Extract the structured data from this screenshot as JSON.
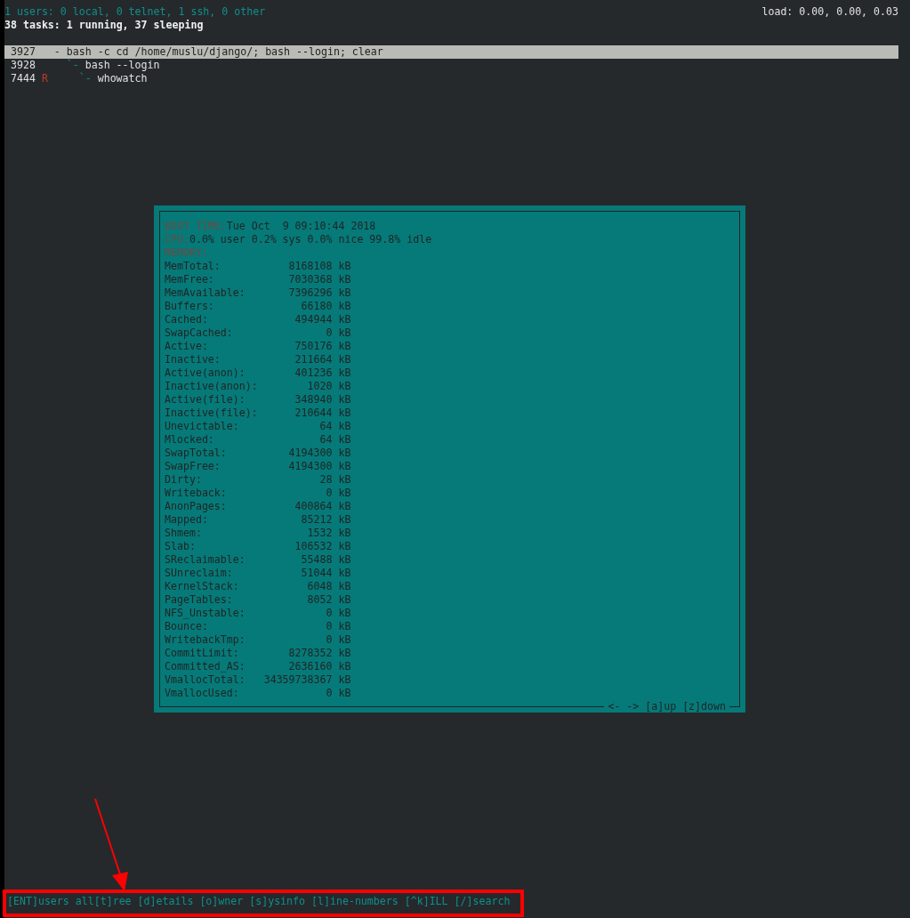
{
  "header": {
    "users_line": "1 users: 0 local, 0 telnet, 1 ssh, 0 other",
    "load": "load: 0.00, 0.00, 0.03",
    "tasks_line": "38 tasks: 1 running, 37 sleeping"
  },
  "processes": [
    {
      "pid": "3927",
      "prefix": "-",
      "command": "bash -c cd /home/muslu/django/; bash --login; clear",
      "selected": true,
      "children": [
        {
          "pid": "3928",
          "prefix": "`-",
          "command": "bash --login",
          "selected": false,
          "children": [
            {
              "pid": "7444",
              "state": "R",
              "prefix": "`-",
              "command": "whowatch",
              "selected": false
            }
          ]
        }
      ]
    }
  ],
  "sysinfo": {
    "boot_label": "BOOT TIME:",
    "boot_value": "Tue Oct  9 09:10:44 2018",
    "cpu_label": "CPU:",
    "cpu_value": "0.0% user 0.2% sys 0.0% nice 99.8% idle",
    "memory_label": "MEMORY:",
    "memory": [
      {
        "name": "MemTotal:",
        "value": "8168108",
        "unit": "kB"
      },
      {
        "name": "MemFree:",
        "value": "7030368",
        "unit": "kB"
      },
      {
        "name": "MemAvailable:",
        "value": "7396296",
        "unit": "kB"
      },
      {
        "name": "Buffers:",
        "value": "66180",
        "unit": "kB"
      },
      {
        "name": "Cached:",
        "value": "494944",
        "unit": "kB"
      },
      {
        "name": "SwapCached:",
        "value": "0",
        "unit": "kB"
      },
      {
        "name": "Active:",
        "value": "750176",
        "unit": "kB"
      },
      {
        "name": "Inactive:",
        "value": "211664",
        "unit": "kB"
      },
      {
        "name": "Active(anon):",
        "value": "401236",
        "unit": "kB"
      },
      {
        "name": "Inactive(anon):",
        "value": "1020",
        "unit": "kB"
      },
      {
        "name": "Active(file):",
        "value": "348940",
        "unit": "kB"
      },
      {
        "name": "Inactive(file):",
        "value": "210644",
        "unit": "kB"
      },
      {
        "name": "Unevictable:",
        "value": "64",
        "unit": "kB"
      },
      {
        "name": "Mlocked:",
        "value": "64",
        "unit": "kB"
      },
      {
        "name": "SwapTotal:",
        "value": "4194300",
        "unit": "kB"
      },
      {
        "name": "SwapFree:",
        "value": "4194300",
        "unit": "kB"
      },
      {
        "name": "Dirty:",
        "value": "28",
        "unit": "kB"
      },
      {
        "name": "Writeback:",
        "value": "0",
        "unit": "kB"
      },
      {
        "name": "AnonPages:",
        "value": "400864",
        "unit": "kB"
      },
      {
        "name": "Mapped:",
        "value": "85212",
        "unit": "kB"
      },
      {
        "name": "Shmem:",
        "value": "1532",
        "unit": "kB"
      },
      {
        "name": "Slab:",
        "value": "106532",
        "unit": "kB"
      },
      {
        "name": "SReclaimable:",
        "value": "55488",
        "unit": "kB"
      },
      {
        "name": "SUnreclaim:",
        "value": "51044",
        "unit": "kB"
      },
      {
        "name": "KernelStack:",
        "value": "6048",
        "unit": "kB"
      },
      {
        "name": "PageTables:",
        "value": "8052",
        "unit": "kB"
      },
      {
        "name": "NFS_Unstable:",
        "value": "0",
        "unit": "kB"
      },
      {
        "name": "Bounce:",
        "value": "0",
        "unit": "kB"
      },
      {
        "name": "WritebackTmp:",
        "value": "0",
        "unit": "kB"
      },
      {
        "name": "CommitLimit:",
        "value": "8278352",
        "unit": "kB"
      },
      {
        "name": "Committed_AS:",
        "value": "2636160",
        "unit": "kB"
      },
      {
        "name": "VmallocTotal:",
        "value": "34359738367",
        "unit": "kB"
      },
      {
        "name": "VmallocUsed:",
        "value": "0",
        "unit": "kB"
      }
    ],
    "scroll_hint": "<- -> [a]up [z]down"
  },
  "status_bar": "[ENT]users all[t]ree [d]etails [o]wner [s]ysinfo [l]ine-numbers [^k]ILL [/]search"
}
